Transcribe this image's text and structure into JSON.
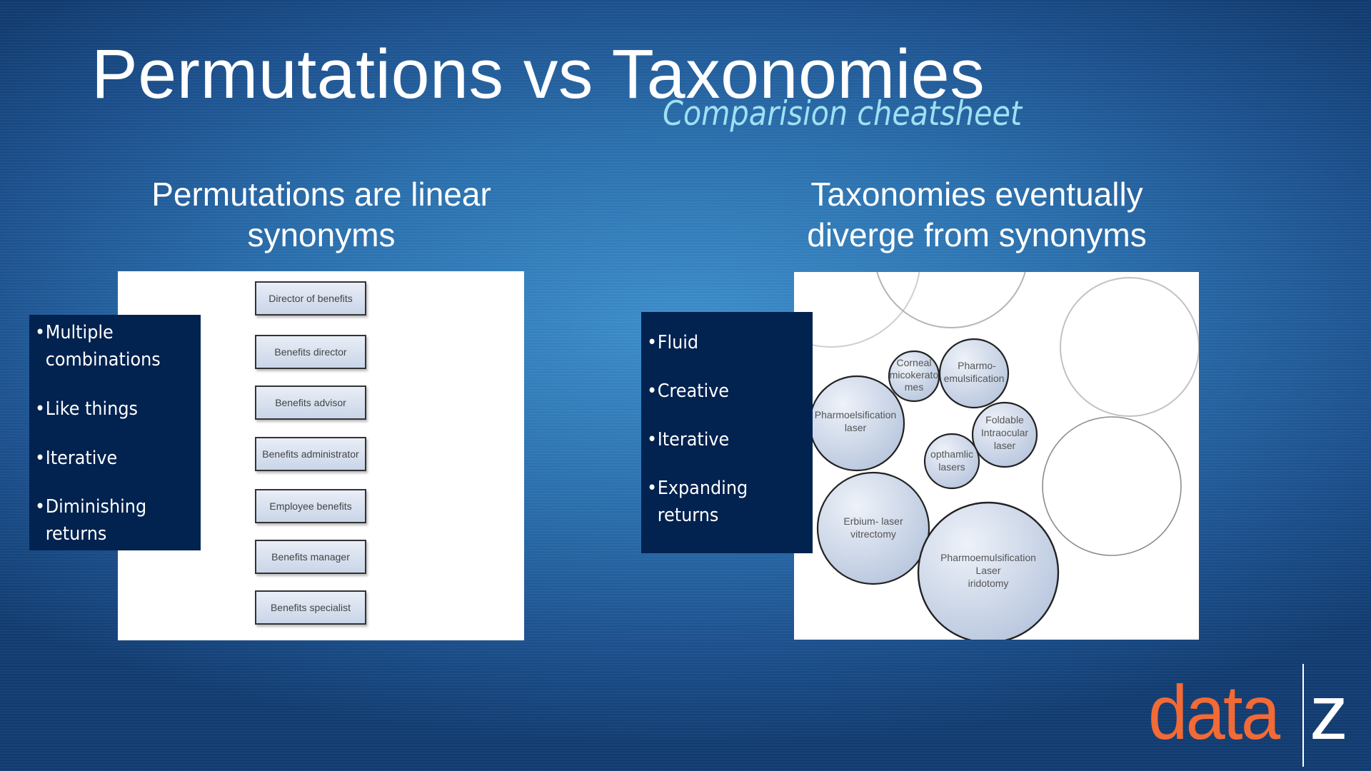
{
  "slide": {
    "title": "Permutations vs Taxonomies",
    "subtitle": "Comparision cheatsheet"
  },
  "left_column": {
    "heading_line1": "Permutations are linear",
    "heading_line2": "synonyms",
    "bullets": [
      "Multiple combinations",
      "Like things",
      "Iterative",
      "Diminishing returns"
    ],
    "bullet_lines": [
      [
        "Multiple",
        "combinations"
      ],
      [
        "Like things"
      ],
      [
        "Iterative"
      ],
      [
        "Diminishing",
        "returns"
      ]
    ],
    "job_titles": [
      "Director of benefits",
      "Benefits director",
      "Benefits advisor",
      "Benefits administrator",
      "Employee benefits",
      "Benefits manager",
      "Benefits specialist"
    ]
  },
  "right_column": {
    "heading_line1": "Taxonomies eventually",
    "heading_line2": "diverge from synonyms",
    "bullets": [
      "Fluid",
      "Creative",
      "Iterative",
      "Expanding returns"
    ],
    "bullet_lines": [
      [
        "Fluid"
      ],
      [
        "Creative"
      ],
      [
        "Iterative"
      ],
      [
        "Expanding",
        "returns"
      ]
    ],
    "bubbles": [
      {
        "lines": [
          "Corneal",
          "micokerato",
          "mes"
        ]
      },
      {
        "lines": [
          "Pharmo-",
          "emulsification"
        ]
      },
      {
        "lines": [
          "Pharmoelsification",
          "laser"
        ]
      },
      {
        "lines": [
          "Foldable",
          "Intraocular",
          "laser"
        ]
      },
      {
        "lines": [
          "opthamlic",
          "lasers"
        ]
      },
      {
        "lines": [
          "Erbium- laser",
          "vitrectomy"
        ]
      },
      {
        "lines": [
          "Pharmoemulsification",
          "Laser",
          "iridotomy"
        ]
      }
    ]
  },
  "logo": {
    "brand_left": "data",
    "brand_right": "z",
    "brand_color": "#f26a36"
  },
  "colors": {
    "navy_box": "#02224f",
    "subtitle": "#9fe0f4"
  }
}
